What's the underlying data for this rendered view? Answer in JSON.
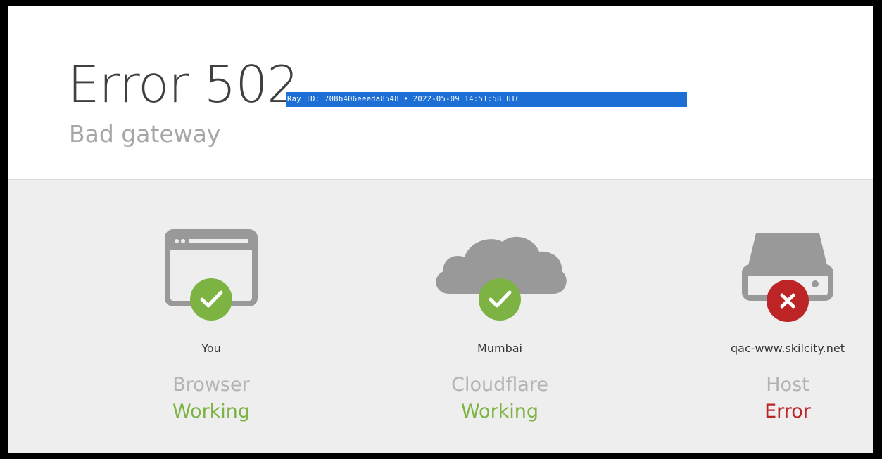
{
  "error": {
    "title": "Error 502",
    "ray_id": "Ray ID: 708b406eeeda8548 • 2022-05-09 14:51:58 UTC",
    "subtitle": "Bad gateway"
  },
  "nodes": [
    {
      "icon": "browser-window-icon",
      "location": "You",
      "role": "Browser",
      "status": "Working",
      "status_color": "#7cb342",
      "badge": "check-icon",
      "badge_color": "#7cb342"
    },
    {
      "icon": "cloud-icon",
      "location": "Mumbai",
      "role": "Cloudflare",
      "status": "Working",
      "status_color": "#7cb342",
      "badge": "check-icon",
      "badge_color": "#7cb342"
    },
    {
      "icon": "server-icon",
      "location": "qac-www.skilcity.net",
      "role": "Host",
      "status": "Error",
      "status_color": "#bd2426",
      "badge": "close-icon",
      "badge_color": "#bd2426"
    }
  ],
  "colors": {
    "icon_gray": "#999999",
    "panel_background": "#eeeeee",
    "selection_blue": "#1d6fd6"
  }
}
